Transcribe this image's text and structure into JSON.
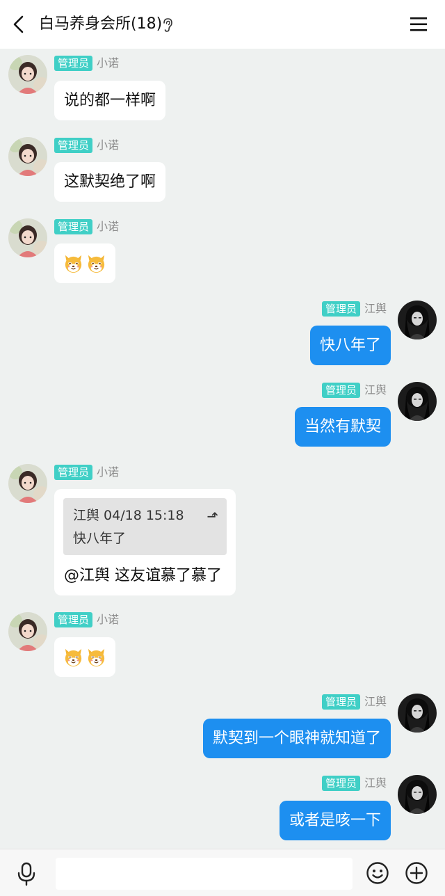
{
  "header": {
    "title": "白马养身会所(18)",
    "accent": "#111111"
  },
  "colors": {
    "background": "#eef1f0",
    "badge": "#40cfc6",
    "self_bubble": "#1d8ff0",
    "other_bubble": "#ffffff"
  },
  "messages": [
    {
      "sender": "小诺",
      "role": "管理员",
      "side": "left",
      "text": "说的都一样啊"
    },
    {
      "sender": "小诺",
      "role": "管理员",
      "side": "left",
      "text": "这默契绝了啊"
    },
    {
      "sender": "小诺",
      "role": "管理员",
      "side": "left",
      "emoji": [
        "dog-face-emoji",
        "dog-face-emoji"
      ]
    },
    {
      "sender": "江舆",
      "role": "管理员",
      "side": "right",
      "text": "快八年了"
    },
    {
      "sender": "江舆",
      "role": "管理员",
      "side": "right",
      "text": "当然有默契"
    },
    {
      "sender": "小诺",
      "role": "管理员",
      "side": "left",
      "quote": {
        "author_time": "江舆 04/18 15:18",
        "text": "快八年了",
        "arrow": "⬏"
      },
      "text": "@江舆 这友谊慕了慕了"
    },
    {
      "sender": "小诺",
      "role": "管理员",
      "side": "left",
      "emoji": [
        "dog-face-emoji",
        "dog-face-emoji"
      ]
    },
    {
      "sender": "江舆",
      "role": "管理员",
      "side": "right",
      "text": "默契到一个眼神就知道了"
    },
    {
      "sender": "江舆",
      "role": "管理员",
      "side": "right",
      "text": "或者是咳一下"
    }
  ],
  "input": {
    "value": "",
    "placeholder": ""
  },
  "icons": {
    "back": "back-arrow-icon",
    "ear": "ear-icon",
    "menu": "menu-icon",
    "mic": "microphone-icon",
    "smile": "smiley-icon",
    "plus": "plus-icon"
  }
}
